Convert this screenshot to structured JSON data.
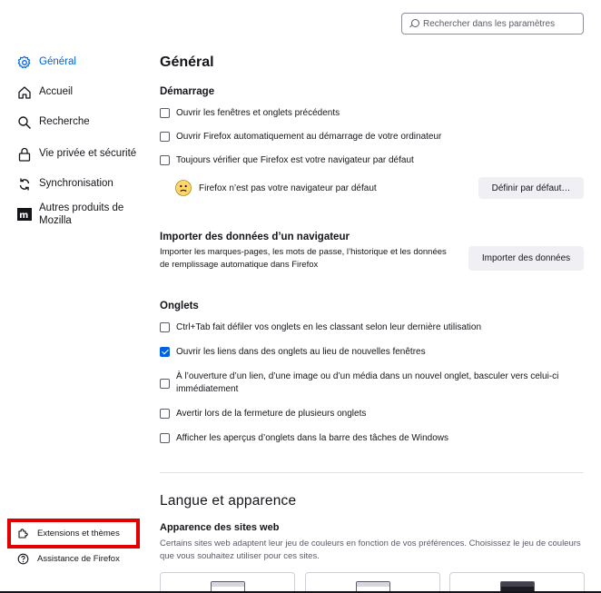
{
  "search": {
    "placeholder": "Rechercher dans les paramètres"
  },
  "sidebar": {
    "items": [
      {
        "label": "Général",
        "icon": "gear-icon"
      },
      {
        "label": "Accueil",
        "icon": "home-icon"
      },
      {
        "label": "Recherche",
        "icon": "search-icon"
      },
      {
        "label": "Vie privée et sécurité",
        "icon": "lock-icon"
      },
      {
        "label": "Synchronisation",
        "icon": "sync-icon"
      },
      {
        "label": "Autres produits de Mozilla",
        "icon": "mozilla-icon"
      }
    ],
    "bottom": [
      {
        "label": "Extensions et thèmes",
        "icon": "puzzle-icon"
      },
      {
        "label": "Assistance de Firefox",
        "icon": "help-icon"
      }
    ]
  },
  "main": {
    "title": "Général",
    "startup": {
      "heading": "Démarrage",
      "options": [
        {
          "label": "Ouvrir les fenêtres et onglets précédents",
          "checked": false
        },
        {
          "label": "Ouvrir Firefox automatiquement au démarrage de votre ordinateur",
          "checked": false
        },
        {
          "label": "Toujours vérifier que Firefox est votre navigateur par défaut",
          "checked": false
        }
      ],
      "default_status": "Firefox n’est pas votre navigateur par défaut",
      "default_button": "Définir par défaut…"
    },
    "import": {
      "heading": "Importer des données d’un navigateur",
      "description": "Importer les marques-pages, les mots de passe, l’historique et les données de remplissage automatique dans Firefox",
      "button": "Importer des données"
    },
    "tabs": {
      "heading": "Onglets",
      "options": [
        {
          "label": "Ctrl+Tab fait défiler vos onglets en les classant selon leur dernière utilisation",
          "checked": false
        },
        {
          "label": "Ouvrir les liens dans des onglets au lieu de nouvelles fenêtres",
          "checked": true
        },
        {
          "label": "À l’ouverture d’un lien, d’une image ou d’un média dans un nouvel onglet, basculer vers celui-ci immédiatement",
          "checked": false
        },
        {
          "label": "Avertir lors de la fermeture de plusieurs onglets",
          "checked": false
        },
        {
          "label": "Afficher les aperçus d’onglets dans la barre des tâches de Windows",
          "checked": false
        }
      ]
    },
    "language": {
      "title": "Langue et apparence",
      "subheading": "Apparence des sites web",
      "description": "Certains sites web adaptent leur jeu de couleurs en fonction de vos préférences. Choisissez le jeu de couleurs que vous souhaitez utiliser pour ces sites."
    }
  },
  "colors": {
    "accent": "#0061e0",
    "highlight": "#e00000",
    "button_bg": "#f0f0f4"
  }
}
